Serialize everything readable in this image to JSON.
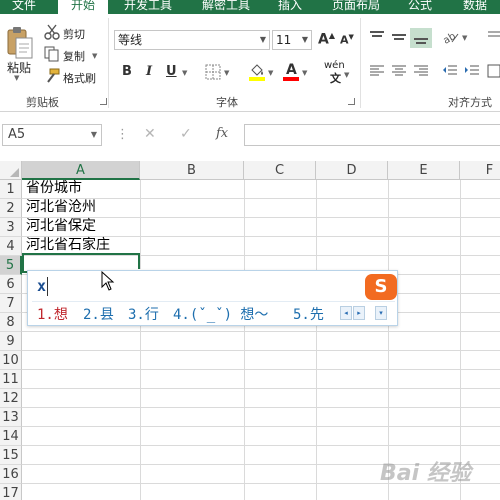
{
  "ribbon_tabs": [
    {
      "label": "文件",
      "active": false
    },
    {
      "label": "开始",
      "active": true
    },
    {
      "label": "开发工具",
      "active": false
    },
    {
      "label": "解密工具",
      "active": false
    },
    {
      "label": "插入",
      "active": false
    },
    {
      "label": "页面布局",
      "active": false
    },
    {
      "label": "公式",
      "active": false
    },
    {
      "label": "数据",
      "active": false
    }
  ],
  "clipboard": {
    "paste_label": "粘贴",
    "cut_label": "剪切",
    "copy_label": "复制",
    "format_painter_label": "格式刷",
    "group_label": "剪贴板"
  },
  "font": {
    "font_name": "等线",
    "font_size": "11",
    "bold": "B",
    "italic": "I",
    "underline": "U",
    "grow": "A",
    "shrink": "A",
    "phonetic": "wén",
    "group_label": "字体"
  },
  "alignment": {
    "group_label": "对齐方式"
  },
  "formula_bar": {
    "name_box": "A5",
    "fx": "fx",
    "cancel": "✕",
    "enter": "✓",
    "dots": "⋮",
    "value": ""
  },
  "columns": [
    "A",
    "B",
    "C",
    "D",
    "E",
    "F"
  ],
  "rows": [
    "1",
    "2",
    "3",
    "4",
    "5",
    "6",
    "7",
    "8",
    "9",
    "10",
    "11",
    "12",
    "13",
    "14",
    "15",
    "16",
    "17"
  ],
  "cells": {
    "A1": "省份城市",
    "A2": "河北省沧州",
    "A3": "河北省保定",
    "A4": "河北省石家庄"
  },
  "active_cell": "A5",
  "ime": {
    "input": "x",
    "logo": "S",
    "candidates": [
      "1.想",
      "2.县",
      "3.行",
      "4.(ˇ_ˇ) 想～",
      "5.先"
    ],
    "prev": "◂",
    "next": "▸",
    "menu": "▾"
  },
  "watermark": "Bai 经验",
  "colors": {
    "excel_green": "#217346",
    "ime_blue": "#1d6eae",
    "ime_first": "#c0272d",
    "sogou_orange": "#f26b21"
  }
}
